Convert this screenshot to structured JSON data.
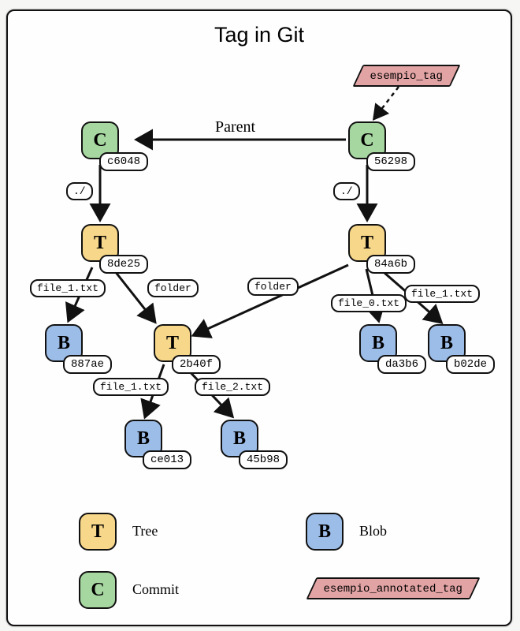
{
  "title": "Tag in Git",
  "nodes": {
    "commit1": {
      "label": "C",
      "hash": "c6048"
    },
    "commit2": {
      "label": "C",
      "hash": "56298"
    },
    "tree1": {
      "label": "T",
      "hash": "8de25"
    },
    "tree2": {
      "label": "T",
      "hash": "84a6b"
    },
    "tree3": {
      "label": "T",
      "hash": "2b40f"
    },
    "blob1": {
      "label": "B",
      "hash": "887ae"
    },
    "blob2": {
      "label": "B",
      "hash": "da3b6"
    },
    "blob3": {
      "label": "B",
      "hash": "b02de"
    },
    "blob4": {
      "label": "B",
      "hash": "ce013"
    },
    "blob5": {
      "label": "B",
      "hash": "45b98"
    }
  },
  "edges": {
    "parent": "Parent",
    "root1": "./",
    "root2": "./",
    "file1a": "file_1.txt",
    "folder_a": "folder",
    "folder_b": "folder",
    "file0": "file_0.txt",
    "file1b": "file_1.txt",
    "file1c": "file_1.txt",
    "file2": "file_2.txt"
  },
  "tags": {
    "lightweight": "esempio_tag",
    "annotated": "esempio_annotated_tag"
  },
  "legend": {
    "tree": "T",
    "tree_label": "Tree",
    "blob": "B",
    "blob_label": "Blob",
    "commit": "C",
    "commit_label": "Commit"
  }
}
